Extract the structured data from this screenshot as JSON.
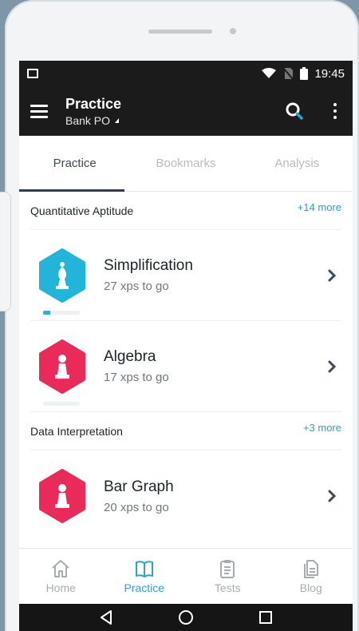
{
  "status_bar": {
    "time": "19:45"
  },
  "app_bar": {
    "title": "Practice",
    "subtitle": "Bank PO"
  },
  "tabs": [
    {
      "label": "Practice",
      "active": true
    },
    {
      "label": "Bookmarks",
      "active": false
    },
    {
      "label": "Analysis",
      "active": false
    }
  ],
  "sections": [
    {
      "title": "Quantitative Aptitude",
      "more": "+14 more",
      "items": [
        {
          "title": "Simplification",
          "subtitle": "27 xps to go",
          "badge_color": "#23b5d9",
          "icon": "bishop-icon",
          "progress": 0.2
        },
        {
          "title": "Algebra",
          "subtitle": "17 xps to go",
          "badge_color": "#ea2b59",
          "icon": "pawn-icon",
          "progress": 0
        }
      ]
    },
    {
      "title": "Data Interpretation",
      "more": "+3 more",
      "items": [
        {
          "title": "Bar Graph",
          "subtitle": "20 xps to go",
          "badge_color": "#ea2b59",
          "icon": "pawn-icon",
          "progress": 0
        }
      ]
    }
  ],
  "bottom_nav": [
    {
      "label": "Home",
      "icon": "home-icon",
      "active": false
    },
    {
      "label": "Practice",
      "icon": "book-icon",
      "active": true
    },
    {
      "label": "Tests",
      "icon": "clipboard-icon",
      "active": false
    },
    {
      "label": "Blog",
      "icon": "document-icon",
      "active": false
    }
  ],
  "colors": {
    "accent": "#2ba4c6",
    "header_bg": "#1b1b1b",
    "progress": "#20b7da"
  }
}
